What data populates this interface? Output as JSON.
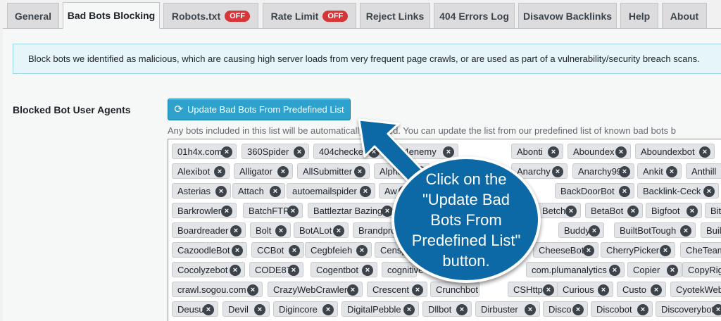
{
  "tabs": [
    {
      "label": "General"
    },
    {
      "label": "Bad Bots Blocking",
      "active": true
    },
    {
      "label": "Robots.txt",
      "badge": "OFF"
    },
    {
      "label": "Rate Limit",
      "badge": "OFF"
    },
    {
      "label": "Reject Links"
    },
    {
      "label": "404 Errors Log"
    },
    {
      "label": "Disavow Backlinks"
    },
    {
      "label": "Help"
    },
    {
      "label": "About"
    }
  ],
  "notice": "Block bots we identified as malicious, which are causing high server loads from very frequent page crawls, or are used as part of a vulnerability/security breach scans.",
  "field_label": "Blocked Bot User Agents",
  "update_button": {
    "label": "Update Bad Bots From Predefined List",
    "icon": "refresh-icon"
  },
  "description": "Any bots included in this list will be automatically blocked. You can update the list from our predefined list of known bad bots b",
  "tags": [
    [
      "01h4x.com",
      "360Spider",
      "404checker",
      "404enemy",
      "",
      "Abonti",
      "Aboundex",
      "Aboundexbot",
      ""
    ],
    [
      "Alexibot",
      "Alligator",
      "AllSubmitter",
      "Alpha",
      "",
      "Anarchy",
      "Anarchy99",
      "Ankit",
      "Anthill"
    ],
    [
      "Asterias",
      "Attach",
      "autoemailspider",
      "Aw",
      "",
      "BackDoorBot",
      "Backlink-Ceck",
      ""
    ],
    [
      "Barkrowler",
      "BatchFTP",
      "Battleztar Bazinga",
      "",
      "Betch",
      "BetaBot",
      "Bigfoot",
      "Bita"
    ],
    [
      "Boardreader",
      "Bolt",
      "BotALot",
      "Brandprotect",
      "",
      "Buddy",
      "BuiltBotTough",
      "BuiltW"
    ],
    [
      "CazoodleBot",
      "CCBot",
      "Cegbfeieh",
      "Censys",
      "CheeseBot",
      "CherryPicker",
      "CheTeam"
    ],
    [
      "Cocolyzebot",
      "CODE87",
      "Cogentbot",
      "cognitive",
      "com.plumanalytics",
      "Copier",
      "CopyRig"
    ],
    [
      "crawl.sogou.com",
      "CrazyWebCrawler",
      "Crescent",
      "Crunchbot",
      "CSHttp",
      "Curious",
      "Custo",
      "CyotekWeb"
    ],
    [
      "Deusu",
      "Devil",
      "Digincore",
      "DigitalPebble",
      "Dllbot",
      "Dirbuster",
      "Disco",
      "Discobot",
      "Discoverybot"
    ]
  ],
  "callout_text": "Click on the \"Update Bad Bots From Predefined List\" button.",
  "colors": {
    "button": "#2ea2cc",
    "callout": "#0d69a5",
    "badge": "#d63638",
    "notice_bg": "#e5f5fa"
  }
}
